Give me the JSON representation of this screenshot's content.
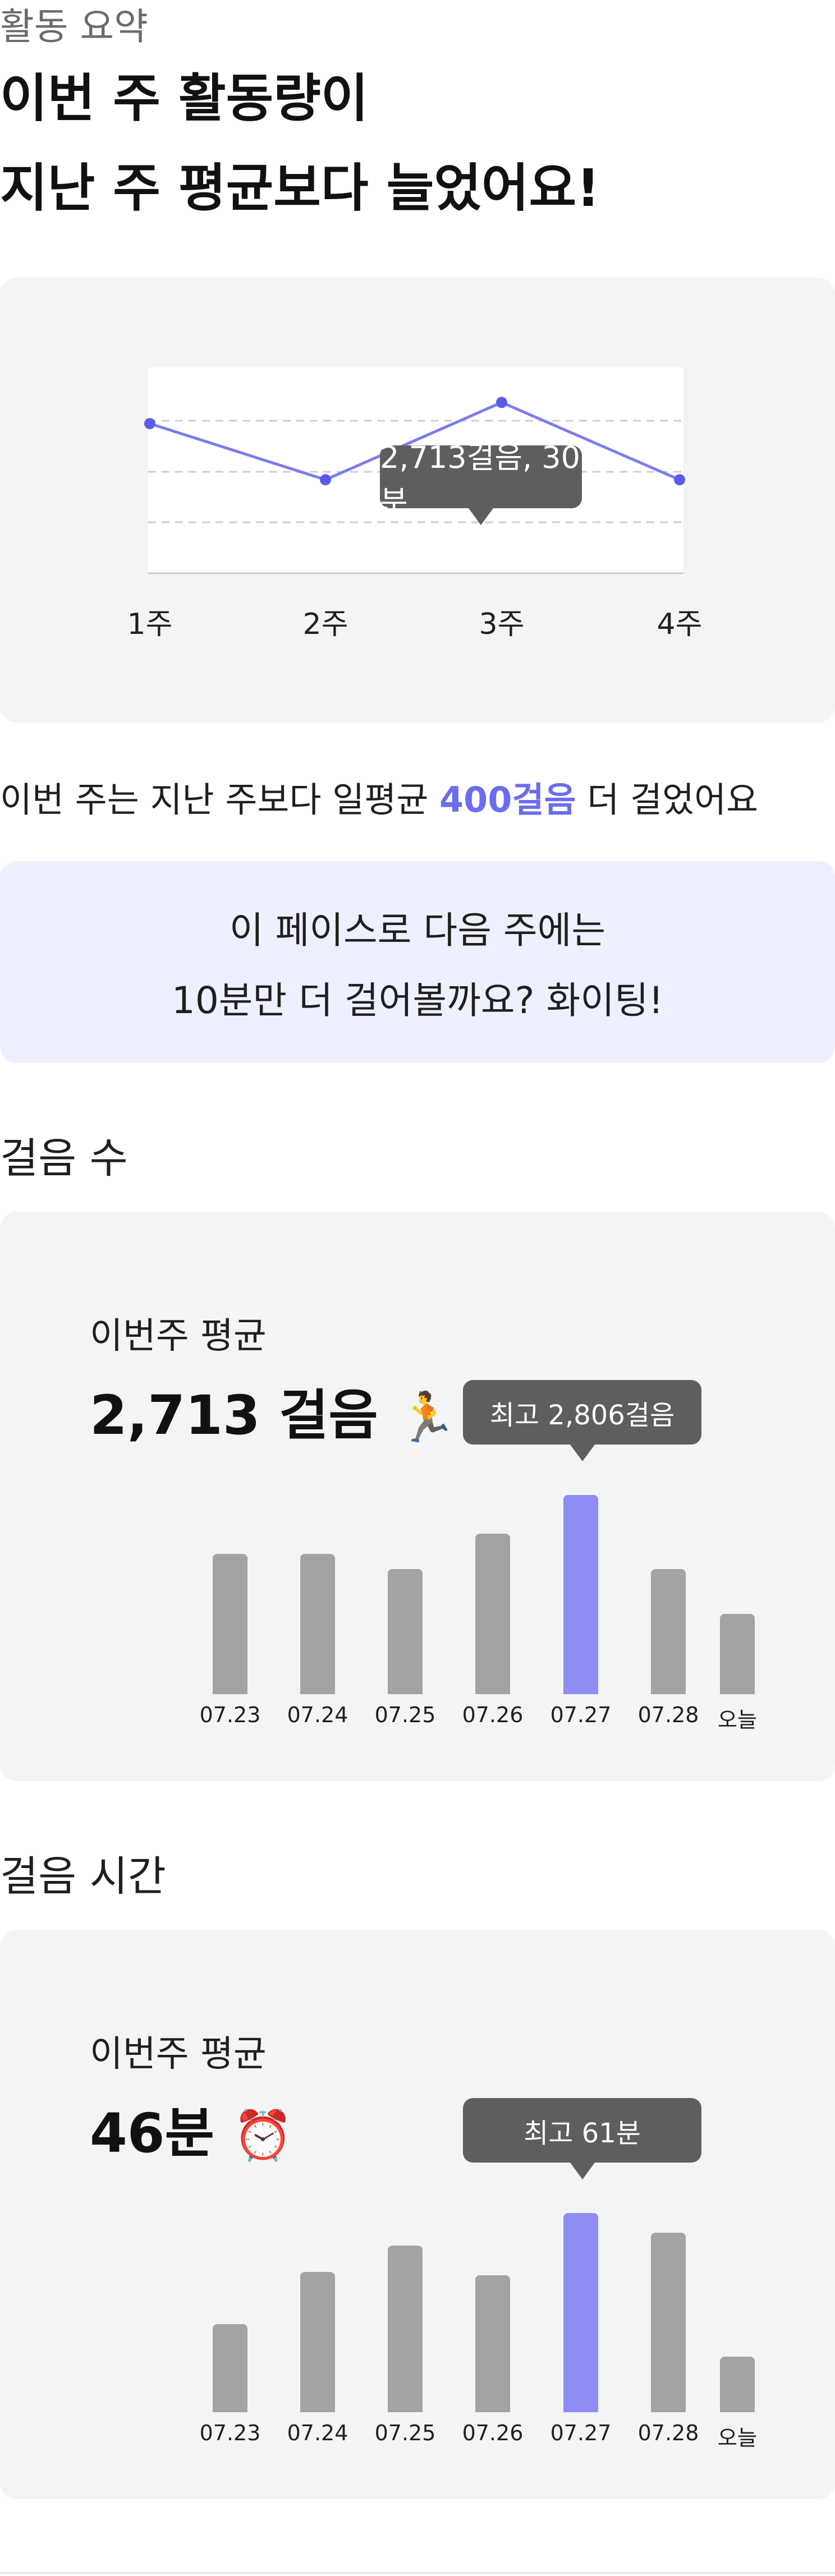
{
  "header": {
    "section_label": "활동 요약",
    "headline_line1": "이번 주 활동량이",
    "headline_line2": "지난 주 평균보다 늘었어요!"
  },
  "weekly_chart": {
    "tooltip": "2,713걸음, 30분",
    "week_labels": [
      "1주",
      "2주",
      "3주",
      "4주"
    ],
    "line_color": "#7b7bf0",
    "point_color": "#5b5bea"
  },
  "comparison": {
    "prefix": "이번 주는 지난 주보다 일평균",
    "highlight": "400걸음",
    "suffix": "더 걸었어요",
    "highlight_color": "#6c6cf0"
  },
  "encourage": {
    "line1": "이 페이스로 다음 주에는",
    "line2": "10분만 더 걸어볼까요? 화이팅!",
    "bg_color": "#eef0ff"
  },
  "steps": {
    "title": "걸음 수",
    "avg_label": "이번주 평균",
    "avg_value": "2,713 걸음",
    "avg_icon": "🏃",
    "tooltip": "최고 2,806걸음"
  },
  "walk_time": {
    "title": "걸음 시간",
    "avg_label": "이번주 평균",
    "avg_value": "46분",
    "avg_icon": "⏰",
    "tooltip": "최고 61분"
  },
  "day_labels": [
    "07.23",
    "07.24",
    "07.25",
    "07.26",
    "07.27",
    "07.28",
    "오늘"
  ],
  "colors": {
    "bar_default": "#a3a3a3",
    "bar_max": "#8f8df5",
    "card_bg": "#f3f4f6",
    "tooltip_bg": "#5e5e5e"
  },
  "chart_data": [
    {
      "type": "line",
      "x": [
        "1주",
        "2주",
        "3주",
        "4주"
      ],
      "values": [
        2600,
        2300,
        2713,
        2300
      ],
      "title": "",
      "xlabel": "",
      "ylabel": "",
      "grid": true
    },
    {
      "type": "bar",
      "categories": [
        "07.23",
        "07.24",
        "07.25",
        "07.26",
        "07.27",
        "07.28",
        "오늘"
      ],
      "values": [
        1980,
        1980,
        1760,
        2260,
        2806,
        1760,
        1130
      ],
      "title": "",
      "xlabel": "",
      "ylabel": ""
    },
    {
      "type": "bar",
      "categories": [
        "07.23",
        "07.24",
        "07.25",
        "07.26",
        "07.27",
        "07.28",
        "오늘"
      ],
      "values": [
        27,
        43,
        51,
        42,
        61,
        55,
        17
      ],
      "title": "",
      "xlabel": "",
      "ylabel": ""
    }
  ]
}
